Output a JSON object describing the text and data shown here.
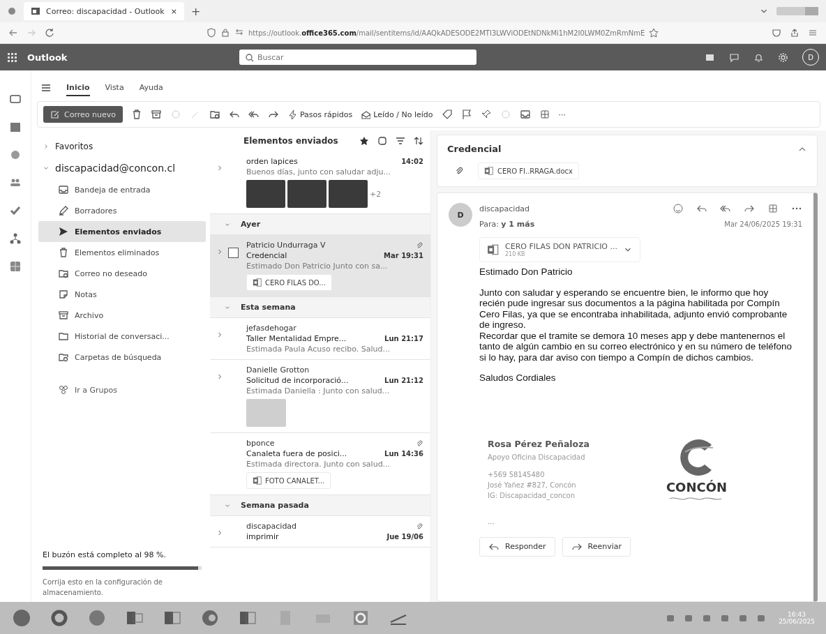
{
  "browser": {
    "tab_title": "Correo: discapacidad - Outlook",
    "tab_close": "×",
    "new_tab": "+",
    "url_prefix": "https://outlook.",
    "url_domain": "office365.com",
    "url_path": "/mail/sentitems/id/AAQkADESODE2MTI3LWViODEtNDNkMi1hM2I0LWM0ZmRmNmE"
  },
  "header": {
    "app_name": "Outlook",
    "search": {
      "placeholder": "Buscar"
    },
    "avatar": "D"
  },
  "ribbon_tabs": [
    {
      "label": "Inicio",
      "selected": true
    },
    {
      "label": "Vista",
      "selected": false
    },
    {
      "label": "Ayuda",
      "selected": false
    }
  ],
  "toolbar": {
    "new_mail": "Correo nuevo",
    "quick_steps": "Pasos rápidos",
    "read_unread": "Leído / No leído",
    "more": "···"
  },
  "folders": {
    "favorites": {
      "label": "Favoritos",
      "expanded": false
    },
    "account": {
      "label": "discapacidad@concon.cl",
      "expanded": true
    },
    "items": [
      {
        "kind": "inbox",
        "label": "Bandeja de entrada",
        "selected": false
      },
      {
        "kind": "drafts",
        "label": "Borradores",
        "selected": false
      },
      {
        "kind": "sent",
        "label": "Elementos enviados",
        "selected": true
      },
      {
        "kind": "deleted",
        "label": "Elementos eliminados",
        "selected": false
      },
      {
        "kind": "junk",
        "label": "Correo no deseado",
        "selected": false
      },
      {
        "kind": "notes",
        "label": "Notas",
        "selected": false
      },
      {
        "kind": "archive",
        "label": "Archivo",
        "selected": false
      },
      {
        "kind": "history",
        "label": "Historial de conversaci...",
        "selected": false
      },
      {
        "kind": "search",
        "label": "Carpetas de búsqueda",
        "selected": false
      }
    ],
    "groups_link": "Ir a Grupos"
  },
  "storage": {
    "message": "El buzón está completo al 98 %.",
    "level": 0.98,
    "hint": "Corrija esto en la configuración de almacenamiento."
  },
  "message_list": {
    "title": "Elementos enviados",
    "sections": [
      {
        "messages": [
          {
            "subject": "orden lapices",
            "time": "14:02",
            "preview": "Buenos días, junto con saludar adju...",
            "thread": true,
            "selected": false,
            "clip": false,
            "thumbnails": [
              {
                "kind": "dark"
              },
              {
                "kind": "dark"
              },
              {
                "kind": "dark"
              }
            ],
            "more_count": "+2"
          }
        ]
      },
      {
        "label": "Ayer",
        "expanded": true,
        "messages": [
          {
            "sender": "Patricio Undurraga V",
            "subject": "Credencial",
            "time": "Mar 19:31",
            "preview": "Estimado Don Patricio Junto con sa...",
            "thread": true,
            "selected": true,
            "clip": true,
            "attachment": "CERO FILAS DO..."
          }
        ]
      },
      {
        "label": "Esta semana",
        "expanded": true,
        "messages": [
          {
            "sender": "jefasdehogar",
            "subject": "Taller Mentalidad Empre...",
            "time": "Lun 21:17",
            "preview": "Estimada Paula Acuso recibo. Salud...",
            "thread": true,
            "selected": false,
            "clip": false
          },
          {
            "sender": "Danielle Grotton",
            "subject": "Solicitud de incorporació...",
            "time": "Lun 21:12",
            "preview": "Estimada Daniella : Junto con salud...",
            "thread": true,
            "selected": false,
            "clip": false,
            "thumbnails": [
              {
                "kind": "light"
              }
            ]
          },
          {
            "sender": "bponce",
            "subject": "Canaleta fuera de posici...",
            "time": "Lun 14:36",
            "preview": "Estimada directora. Junto con salud...",
            "thread": false,
            "selected": false,
            "clip": true,
            "attachment": "FOTO CANALET..."
          }
        ]
      },
      {
        "label": "Semana pasada",
        "expanded": true,
        "messages": [
          {
            "sender": "discapacidad",
            "subject": "imprimir",
            "time": "Jue 19/06",
            "thread": true,
            "selected": false,
            "clip": true
          }
        ]
      }
    ]
  },
  "reading_pane": {
    "subject": "Credencial",
    "top_attachment": "CERO FI..RRAGA.docx",
    "sender": "discapacidad",
    "avatar": "D",
    "to": "Para: **y 1 más**",
    "date": "Mar 24/06/2025 19:31",
    "attachment": {
      "name": "CERO FILAS DON PATRICIO ...",
      "size": "210 KB"
    },
    "body": [
      "Estimado Don Patricio",
      "Junto con saludar y esperando se encuentre bien, le informo que hoy recién pude ingresar sus documentos a la página habilitada por Compín Cero Filas, ya que se encontraba inhabilitada, adjunto envió comprobante de ingreso.\nRecordar que el tramite se demora 10 meses app y debe mantenernos el tanto de algún cambio en su correo electrónico y en su número de teléfono si lo hay, para dar aviso con tiempo a Compín de dichos cambios.",
      "Saludos Cordiales"
    ],
    "signature": {
      "name": "Rosa Pérez Peñaloza",
      "role": "Apoyo Oficina Discapacidad",
      "phone": "+569 58145480",
      "address": "José Yañez #827, Concón",
      "instagram": "IG: Discapacidad_concon",
      "logo_text": "CONCÓN"
    },
    "ellipsis": "···",
    "buttons": [
      "Responder",
      "Reenviar"
    ]
  },
  "taskbar": {
    "time": "16:43",
    "date": "25/06/2025"
  }
}
